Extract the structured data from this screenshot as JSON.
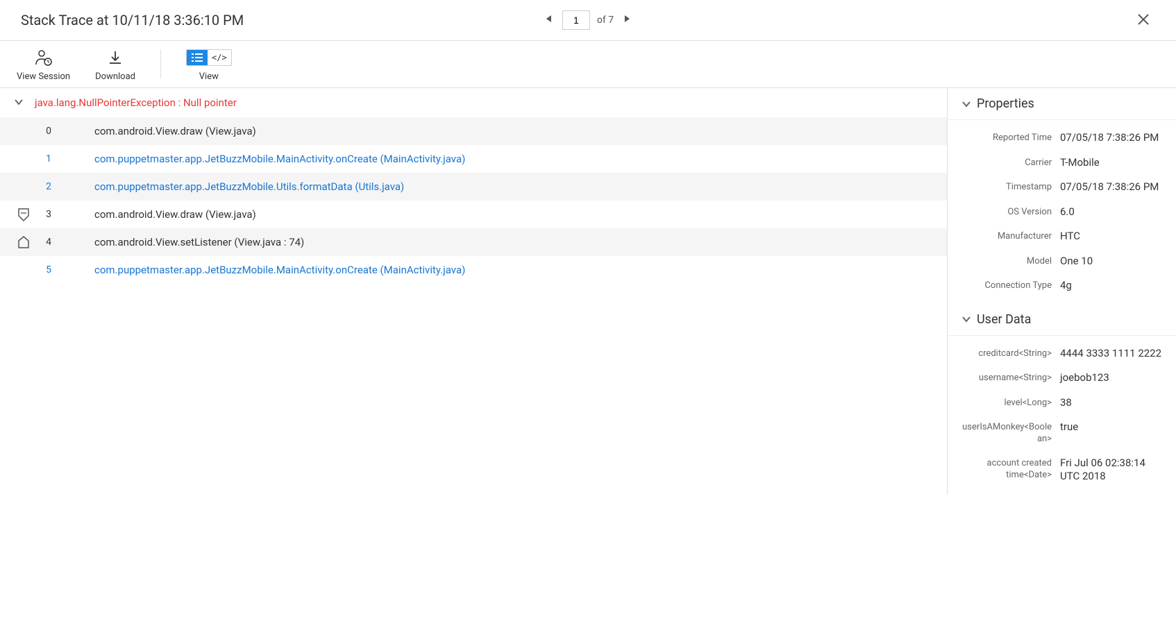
{
  "header": {
    "title": "Stack Trace at 10/11/18 3:36:10 PM",
    "pagination": {
      "current": "1",
      "total_label": "of 7"
    }
  },
  "toolbar": {
    "view_session": "View Session",
    "download": "Download",
    "view": "View",
    "view_toggle_raw": "</>"
  },
  "exception": {
    "text": "java.lang.NullPointerException : Null pointer"
  },
  "frames": [
    {
      "index": "0",
      "text": "com.android.View.draw (View.java)",
      "link": false,
      "shaded": true,
      "icon": null
    },
    {
      "index": "1",
      "text": "com.puppetmaster.app.JetBuzzMobile.MainActivity.onCreate (MainActivity.java)",
      "link": true,
      "shaded": false,
      "icon": null
    },
    {
      "index": "2",
      "text": "com.puppetmaster.app.JetBuzzMobile.Utils.formatData (Utils.java)",
      "link": true,
      "shaded": true,
      "icon": null
    },
    {
      "index": "3",
      "text": "com.android.View.draw (View.java)",
      "link": false,
      "shaded": false,
      "icon": "shield"
    },
    {
      "index": "4",
      "text": "com.android.View.setListener (View.java : 74)",
      "link": false,
      "shaded": true,
      "icon": "home"
    },
    {
      "index": "5",
      "text": "com.puppetmaster.app.JetBuzzMobile.MainActivity.onCreate (MainActivity.java)",
      "link": true,
      "shaded": false,
      "icon": null
    }
  ],
  "properties": {
    "section_title": "Properties",
    "items": [
      {
        "label": "Reported Time",
        "value": "07/05/18 7:38:26 PM"
      },
      {
        "label": "Carrier",
        "value": "T-Mobile"
      },
      {
        "label": "Timestamp",
        "value": "07/05/18 7:38:26 PM"
      },
      {
        "label": "OS Version",
        "value": "6.0"
      },
      {
        "label": "Manufacturer",
        "value": "HTC"
      },
      {
        "label": "Model",
        "value": "One 10"
      },
      {
        "label": "Connection Type",
        "value": "4g"
      }
    ]
  },
  "user_data": {
    "section_title": "User Data",
    "items": [
      {
        "label": "creditcard<String>",
        "value": "4444 3333 1111 2222"
      },
      {
        "label": "username<String>",
        "value": "joebob123"
      },
      {
        "label": "level<Long>",
        "value": "38"
      },
      {
        "label": "userIsAMonkey<Boolean>",
        "value": "true"
      },
      {
        "label": "account created time<Date>",
        "value": "Fri Jul 06 02:38:14 UTC 2018"
      }
    ]
  }
}
